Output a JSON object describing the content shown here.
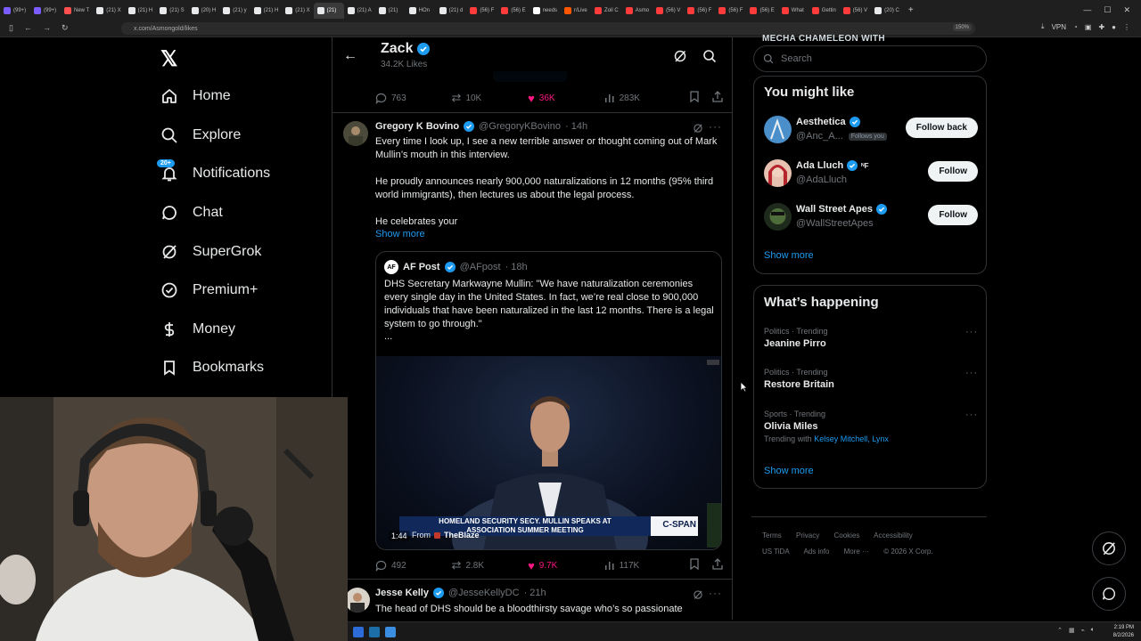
{
  "browser": {
    "tabs": [
      {
        "label": "(99+)",
        "color": "#7b5cff"
      },
      {
        "label": "(99+)",
        "color": "#7b5cff"
      },
      {
        "label": "New T",
        "color": "#ff4f4f"
      },
      {
        "label": "(21) X",
        "color": "#e7e9ea"
      },
      {
        "label": "(21) H",
        "color": "#e7e9ea"
      },
      {
        "label": "(21) S",
        "color": "#e7e9ea"
      },
      {
        "label": "(20) H",
        "color": "#e7e9ea"
      },
      {
        "label": "(21) y",
        "color": "#e7e9ea"
      },
      {
        "label": "(21) H",
        "color": "#e7e9ea"
      },
      {
        "label": "(21) X",
        "color": "#e7e9ea"
      },
      {
        "label": "(21)",
        "color": "#e7e9ea",
        "active": true
      },
      {
        "label": "(21) A",
        "color": "#e7e9ea"
      },
      {
        "label": "(21)",
        "color": "#e7e9ea"
      },
      {
        "label": "HOn",
        "color": "#e7e9ea"
      },
      {
        "label": "(21) d",
        "color": "#e7e9ea"
      },
      {
        "label": "(56) F",
        "color": "#ff3b3b"
      },
      {
        "label": "(56) E",
        "color": "#ff3b3b"
      },
      {
        "label": "needs",
        "color": "#ffffff"
      },
      {
        "label": "r/Live",
        "color": "#ff5700"
      },
      {
        "label": "Zoil C",
        "color": "#ff3b3b"
      },
      {
        "label": "Asmo",
        "color": "#ff3b3b"
      },
      {
        "label": "(56) V",
        "color": "#ff3b3b"
      },
      {
        "label": "(56) F",
        "color": "#ff3b3b"
      },
      {
        "label": "(56) F",
        "color": "#ff3b3b"
      },
      {
        "label": "(56) E",
        "color": "#ff3b3b"
      },
      {
        "label": "What",
        "color": "#ff3b3b"
      },
      {
        "label": "Gettin",
        "color": "#ff3b3b"
      },
      {
        "label": "(56) V",
        "color": "#ff3b3b"
      },
      {
        "label": "(20) C",
        "color": "#e7e9ea"
      }
    ],
    "url": "x.com/Asmongold/likes",
    "zoom": "150%",
    "vpn": "VPN"
  },
  "sidebar": {
    "logo": "𝕏",
    "items": [
      {
        "label": "Home",
        "icon": "home-icon"
      },
      {
        "label": "Explore",
        "icon": "search-icon"
      },
      {
        "label": "Notifications",
        "icon": "bell-icon",
        "badge": "20+"
      },
      {
        "label": "Chat",
        "icon": "chat-icon"
      },
      {
        "label": "SuperGrok",
        "icon": "grok-icon"
      },
      {
        "label": "Premium+",
        "icon": "premium-icon"
      },
      {
        "label": "Money",
        "icon": "money-icon"
      },
      {
        "label": "Bookmarks",
        "icon": "bookmark-icon"
      }
    ]
  },
  "header": {
    "name": "Zack",
    "subtitle": "34.2K Likes"
  },
  "prev_metrics": {
    "replies": "763",
    "reposts": "10K",
    "likes": "36K",
    "views": "283K"
  },
  "tweet1": {
    "name": "Gregory K Bovino",
    "handle": "@GregoryKBovino",
    "time": "· 14h",
    "paragraphs": [
      "Every time I look up, I see a new terrible answer or thought coming out of Mark Mullin’s mouth in this interview.",
      "He proudly announces nearly 900,000 naturalizations in 12 months (95% third world immigrants), then lectures us about the legal process.",
      "He celebrates your"
    ],
    "show_more": "Show more",
    "quote": {
      "avatar": "AF",
      "name": "AF Post",
      "handle": "@AFpost",
      "time": "· 18h",
      "text": "DHS Secretary Markwayne Mullin: \"We have naturalization ceremonies every single day in the United States. In fact, we’re real close to 900,000 individuals that have been naturalized in the last 12 months. There is a legal system to go through.\"",
      "ellipsis": "...",
      "video": {
        "chyron_line1": "HOMELAND SECURITY SECY. MULLIN SPEAKS AT",
        "chyron_line2": "ASSOCIATION SUMMER MEETING",
        "network": "C-SPAN",
        "duration": "1:44",
        "from_label": "From",
        "from_source": "TheBlaze"
      }
    },
    "metrics": {
      "replies": "492",
      "reposts": "2.8K",
      "likes": "9.7K",
      "views": "117K"
    }
  },
  "tweet2": {
    "name": "Jesse Kelly",
    "handle": "@JesseKellyDC",
    "time": "· 21h",
    "text": "The head of DHS should be a bloodthirsty savage who’s so passionate"
  },
  "right": {
    "top_cut": "MECHA CHAMELEON WITH",
    "search_placeholder": "Search",
    "suggest_title": "You might like",
    "suggestions": [
      {
        "name": "Aesthetica",
        "handle": "@Anc_A...",
        "follows_you": "Follows you",
        "button": "Follow back",
        "extra": ""
      },
      {
        "name": "Ada Lluch",
        "handle": "@AdaLluch",
        "follows_you": "",
        "button": "Follow",
        "extra": "ᴺF"
      },
      {
        "name": "Wall Street Apes",
        "handle": "@WallStreetApes",
        "follows_you": "",
        "button": "Follow",
        "extra": ""
      }
    ],
    "show_more": "Show more",
    "happening_title": "What’s happening",
    "trends": [
      {
        "category": "Politics · Trending",
        "title": "Jeanine Pirro",
        "with": ""
      },
      {
        "category": "Politics · Trending",
        "title": "Restore Britain",
        "with": ""
      },
      {
        "category": "Sports · Trending",
        "title": "Olivia Miles",
        "with_label": "Trending with",
        "with": "Kelsey Mitchell, Lynx"
      }
    ],
    "show_more2": "Show more",
    "footer": [
      "Terms",
      "Privacy",
      "Cookies",
      "Accessibility",
      "US TiDA",
      "Ads info",
      "More ···",
      "© 2026 X Corp."
    ]
  },
  "taskbar": {
    "time": "2:19 PM",
    "date": "8/2/2026"
  }
}
